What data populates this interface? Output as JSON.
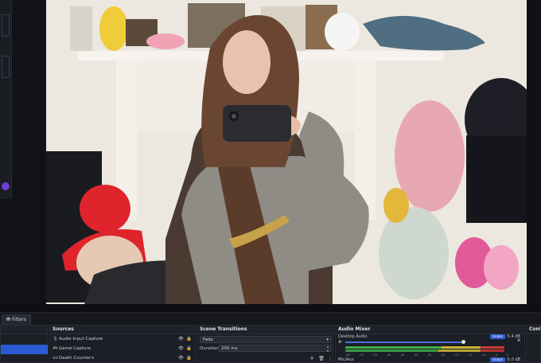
{
  "dock_bar": {
    "filters_label": "Filters"
  },
  "docks": {
    "sources_title": "Sources",
    "transitions_title": "Scene Transitions",
    "mixer_title": "Audio Mixer",
    "controls_title": "Contr"
  },
  "sources": [
    {
      "name": "Audio Input Capture",
      "icon": "mic-icon"
    },
    {
      "name": "Game Capture",
      "icon": "gamepad-icon"
    },
    {
      "name": "Death Counter+",
      "icon": "text-icon"
    }
  ],
  "transitions": {
    "selected": "Fade",
    "duration_label": "Duration",
    "duration_value": "200 ms"
  },
  "mixer": {
    "channels": [
      {
        "name": "Desktop Audio",
        "global_label": "Global",
        "level": "-5.4 dB",
        "scale": [
          "-60",
          "-55",
          "-50",
          "-45",
          "-40",
          "-35",
          "-30",
          "-25",
          "-20",
          "-15",
          "-10",
          "-5",
          "0"
        ]
      },
      {
        "name": "Mic/Aux",
        "global_label": "Global",
        "level": "-5.0 dB"
      }
    ]
  },
  "colors": {
    "accent": "#2b5bd4",
    "meter_green": "#3fae4a",
    "meter_yellow": "#c9b43a",
    "meter_red": "#c83a3a"
  }
}
